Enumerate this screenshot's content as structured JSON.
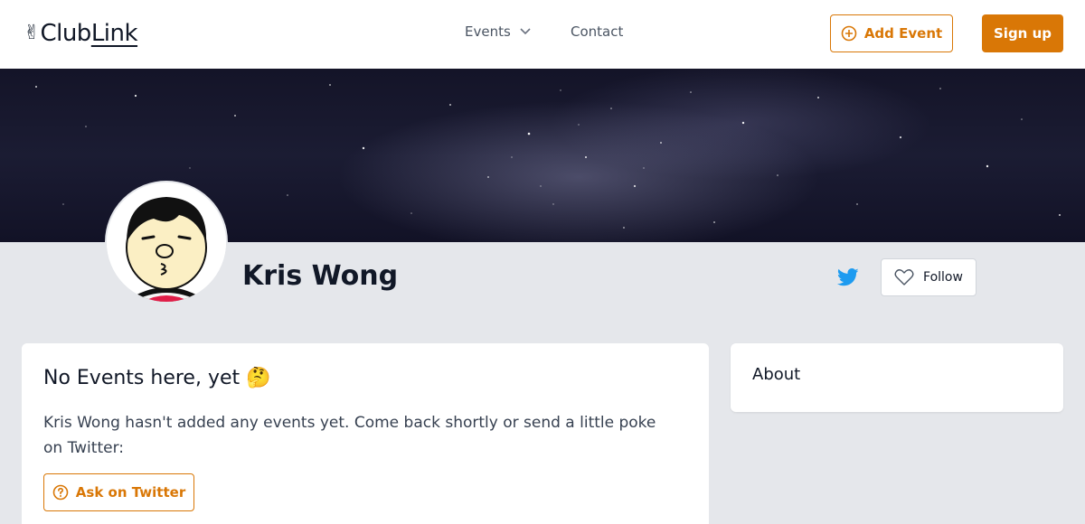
{
  "header": {
    "logo_emoji": "✌",
    "logo_part1": "Club",
    "logo_part2": "Link",
    "nav_events_label": "Events",
    "nav_contact_label": "Contact",
    "add_event_label": "Add Event",
    "signup_label": "Sign up"
  },
  "profile": {
    "name": "Kris Wong",
    "follow_label": "Follow",
    "social_icon": "twitter-icon"
  },
  "events_card": {
    "title": "No Events here, yet 🤔",
    "message": "Kris Wong hasn't added any events yet. Come back shortly or send a little poke on Twitter:",
    "ask_label": "Ask on Twitter"
  },
  "about_card": {
    "title": "About"
  },
  "colors": {
    "accent": "#d97706",
    "page_bg": "#e5e7eb",
    "twitter": "#1d9bf0"
  }
}
